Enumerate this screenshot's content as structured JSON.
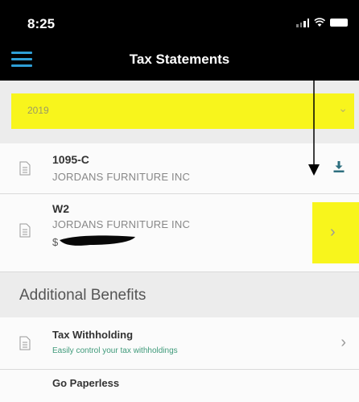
{
  "status_bar": {
    "time": "8:25"
  },
  "nav": {
    "title": "Tax Statements"
  },
  "year_selector": {
    "value": "2019"
  },
  "statements": [
    {
      "title": "1095-C",
      "employer": "JORDANS FURNITURE INC",
      "action": "download-icon"
    },
    {
      "title": "W2",
      "employer": "JORDANS FURNITURE INC",
      "amount_prefix": "$",
      "action": "chevron-right-icon"
    }
  ],
  "section": {
    "title": "Additional Benefits"
  },
  "benefits": [
    {
      "title": "Tax Withholding",
      "subtitle": "Easily control your tax withholdings",
      "action": "chevron-right-icon"
    },
    {
      "title": "Go Paperless"
    }
  ],
  "colors": {
    "header_bg": "#000000",
    "accent_blue": "#2f9fd6",
    "highlight_yellow": "#f8f51c",
    "download_teal": "#2e6f7f",
    "subtitle_green": "#3f9a7a"
  }
}
